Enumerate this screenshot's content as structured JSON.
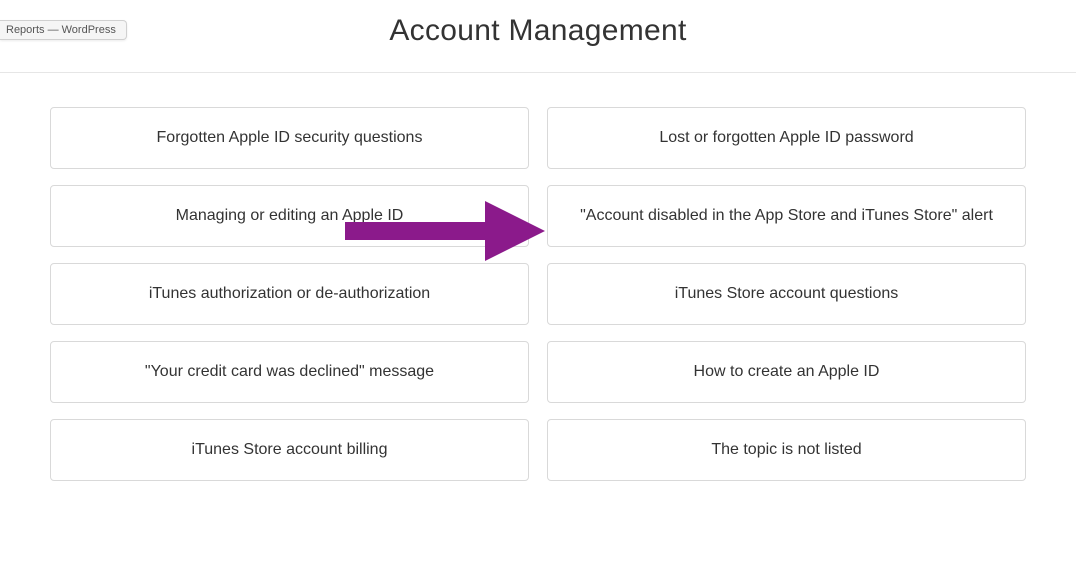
{
  "bookmark": {
    "label": "Reports — WordPress"
  },
  "header": {
    "title": "Account Management"
  },
  "options": [
    {
      "label": "Forgotten Apple ID security questions"
    },
    {
      "label": "Lost or forgotten Apple ID password"
    },
    {
      "label": "Managing or editing an Apple ID"
    },
    {
      "label": "\"Account disabled in the App Store and iTunes Store\" alert"
    },
    {
      "label": "iTunes authorization or de-authorization"
    },
    {
      "label": "iTunes Store account questions"
    },
    {
      "label": "\"Your credit card was declined\" message"
    },
    {
      "label": "How to create an Apple ID"
    },
    {
      "label": "iTunes Store account billing"
    },
    {
      "label": "The topic is not listed"
    }
  ],
  "annotation": {
    "arrow_color": "#8b1a8b"
  }
}
